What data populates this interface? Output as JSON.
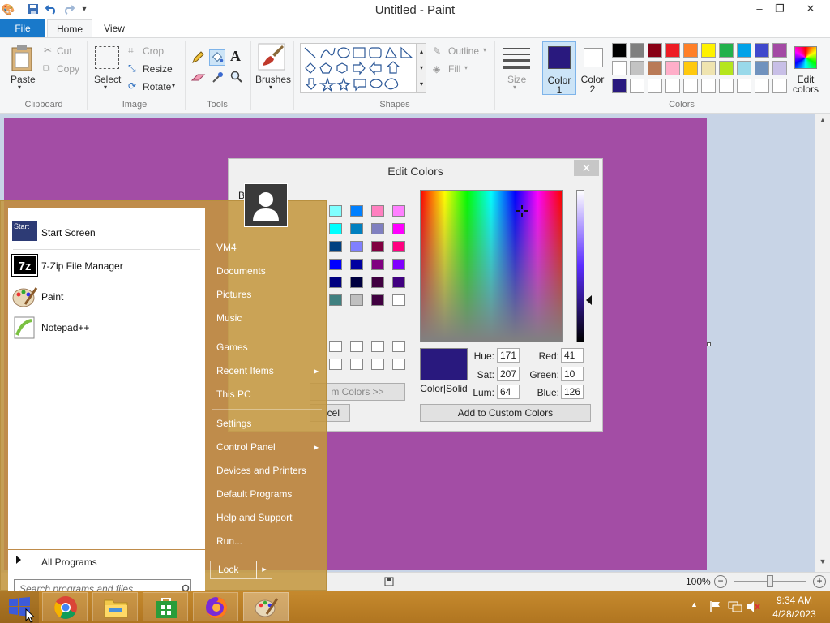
{
  "app": {
    "title": "Untitled - Paint",
    "window_controls": {
      "minimize": "–",
      "restore": "❐",
      "close": "✕"
    }
  },
  "tabs": {
    "file": "File",
    "home": "Home",
    "view": "View"
  },
  "ribbon": {
    "clipboard": {
      "paste": "Paste",
      "cut": "Cut",
      "copy": "Copy",
      "label": "Clipboard"
    },
    "image": {
      "select": "Select",
      "crop": "Crop",
      "resize": "Resize",
      "rotate": "Rotate",
      "label": "Image"
    },
    "tools": {
      "label": "Tools",
      "text_glyph": "A"
    },
    "brushes": {
      "label": "Brushes"
    },
    "shapes": {
      "outline": "Outline",
      "fill": "Fill",
      "label": "Shapes"
    },
    "size": {
      "label": "Size"
    },
    "colors": {
      "color1": "Color",
      "color1_num": "1",
      "color2": "Color",
      "color2_num": "2",
      "edit_colors_line1": "Edit",
      "edit_colors_line2": "colors",
      "label": "Colors",
      "color1_value": "#29197e",
      "color2_value": "#ffffff",
      "palette_row1": [
        "#000000",
        "#7f7f7f",
        "#880015",
        "#ed1c24",
        "#ff7f27",
        "#fff200",
        "#22b14c",
        "#00a2e8",
        "#3f48cc",
        "#a349a4"
      ],
      "palette_row2": [
        "#ffffff",
        "#c3c3c3",
        "#b97a57",
        "#ffaec9",
        "#ffc90e",
        "#efe4b0",
        "#b5e61d",
        "#99d9ea",
        "#7092be",
        "#c8bfe7"
      ],
      "palette_row3": [
        "#29197e",
        "#ffffff",
        "#ffffff",
        "#ffffff",
        "#ffffff",
        "#ffffff",
        "#ffffff",
        "#ffffff",
        "#ffffff",
        "#ffffff"
      ]
    }
  },
  "canvas": {
    "background": "#a34da5"
  },
  "status": {
    "zoom": "100%",
    "zoom_out": "−",
    "zoom_in": "+"
  },
  "dialog": {
    "title": "Edit Colors",
    "close": "✕",
    "basic_label_fragment": "B",
    "custom_colors_button": "m Colors >>",
    "cancel_fragment": "cel",
    "color_solid_label": "Color|Solid",
    "hue_label": "Hue:",
    "hue": "171",
    "sat_label": "Sat:",
    "sat": "207",
    "lum_label": "Lum:",
    "lum": "64",
    "red_label": "Red:",
    "red": "41",
    "green_label": "Green:",
    "green": "10",
    "blue_label": "Blue:",
    "blue": "126",
    "add_custom": "Add to Custom Colors",
    "preview_color": "#29197e"
  },
  "start_menu": {
    "programs": [
      {
        "label": "Start Screen"
      },
      {
        "label": "7-Zip File Manager",
        "icon_text": "7z"
      },
      {
        "label": "Paint"
      },
      {
        "label": "Notepad++"
      }
    ],
    "start_icon_text": "Start",
    "all_programs": "All Programs",
    "search_placeholder": "Search programs and files",
    "links": {
      "user": "VM4",
      "documents": "Documents",
      "pictures": "Pictures",
      "music": "Music",
      "games": "Games",
      "recent_items": "Recent Items",
      "this_pc": "This PC",
      "settings": "Settings",
      "control_panel": "Control Panel",
      "devices": "Devices and Printers",
      "default_programs": "Default Programs",
      "help": "Help and Support",
      "run": "Run..."
    },
    "lock": "Lock"
  },
  "taskbar": {
    "time": "9:34 AM",
    "date": "4/28/2023"
  }
}
